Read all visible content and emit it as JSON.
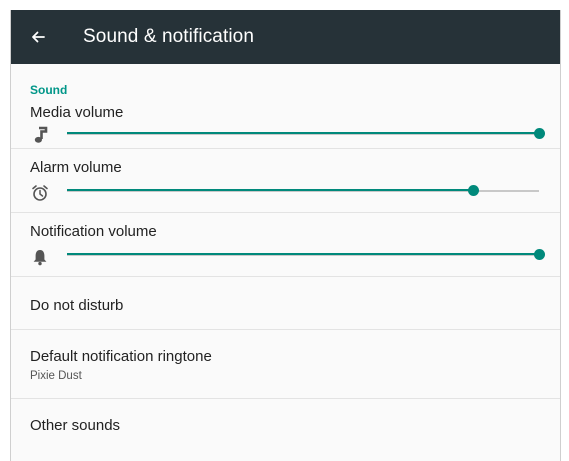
{
  "appbar": {
    "title": "Sound & notification"
  },
  "sound_section": {
    "header": "Sound",
    "sliders": [
      {
        "label": "Media volume",
        "icon": "music-note-icon",
        "level": 1.0
      },
      {
        "label": "Alarm volume",
        "icon": "alarm-clock-icon",
        "level": 0.86
      },
      {
        "label": "Notification volume",
        "icon": "bell-icon",
        "level": 1.0
      }
    ]
  },
  "items": {
    "do_not_disturb": {
      "title": "Do not disturb"
    },
    "ringtone": {
      "title": "Default notification ringtone",
      "summary": "Pixie Dust"
    },
    "other_sounds": {
      "title": "Other sounds"
    }
  },
  "colors": {
    "appbar": "#263238",
    "accent": "#009688",
    "track_inactive": "#c8c8c8"
  }
}
